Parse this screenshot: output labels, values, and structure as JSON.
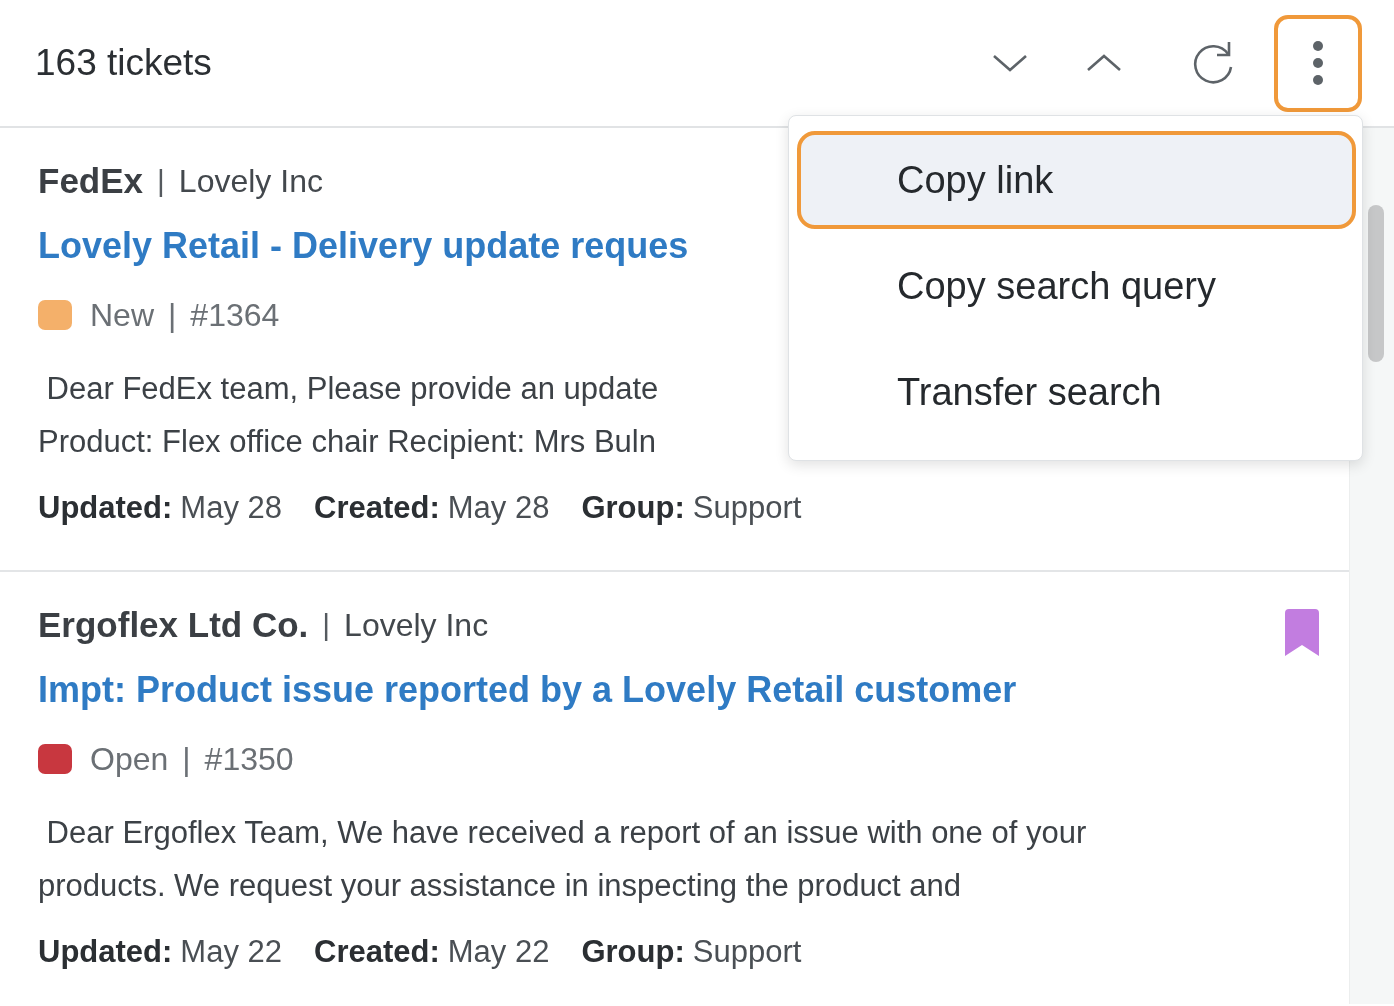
{
  "header": {
    "count": "163 tickets",
    "more_button": {
      "focused": true
    }
  },
  "tickets": [
    {
      "org": "FedEx",
      "separator": "|",
      "company": "Lovely Inc",
      "title": "Lovely Retail - Delivery update reques",
      "bookmarked": false,
      "status": {
        "label": "New",
        "color": "#f4b06a"
      },
      "status_separator": "|",
      "number": "#1364",
      "body_lines": [
        " Dear FedEx team, Please provide an update",
        "Product: Flex office chair Recipient: Mrs Buln"
      ],
      "meta": [
        {
          "label": "Updated:",
          "value": "May 28"
        },
        {
          "label": "Created:",
          "value": "May 28"
        },
        {
          "label": "Group:",
          "value": "Support"
        }
      ]
    },
    {
      "org": "Ergoflex Ltd Co.",
      "separator": "|",
      "company": "Lovely Inc",
      "title": "Impt: Product issue reported by a Lovely Retail customer",
      "bookmarked": true,
      "status": {
        "label": "Open",
        "color": "#c8373f"
      },
      "status_separator": "|",
      "number": "#1350",
      "body_lines": [
        " Dear Ergoflex Team, We have received a report of an issue with one of your",
        "products. We request your assistance in inspecting the product and"
      ],
      "meta": [
        {
          "label": "Updated:",
          "value": "May 22"
        },
        {
          "label": "Created:",
          "value": "May 22"
        },
        {
          "label": "Group:",
          "value": "Support"
        }
      ]
    }
  ],
  "menu": {
    "items": [
      {
        "label": "Copy link",
        "selected": true
      },
      {
        "label": "Copy search query",
        "selected": false
      },
      {
        "label": "Transfer search",
        "selected": false
      }
    ]
  }
}
